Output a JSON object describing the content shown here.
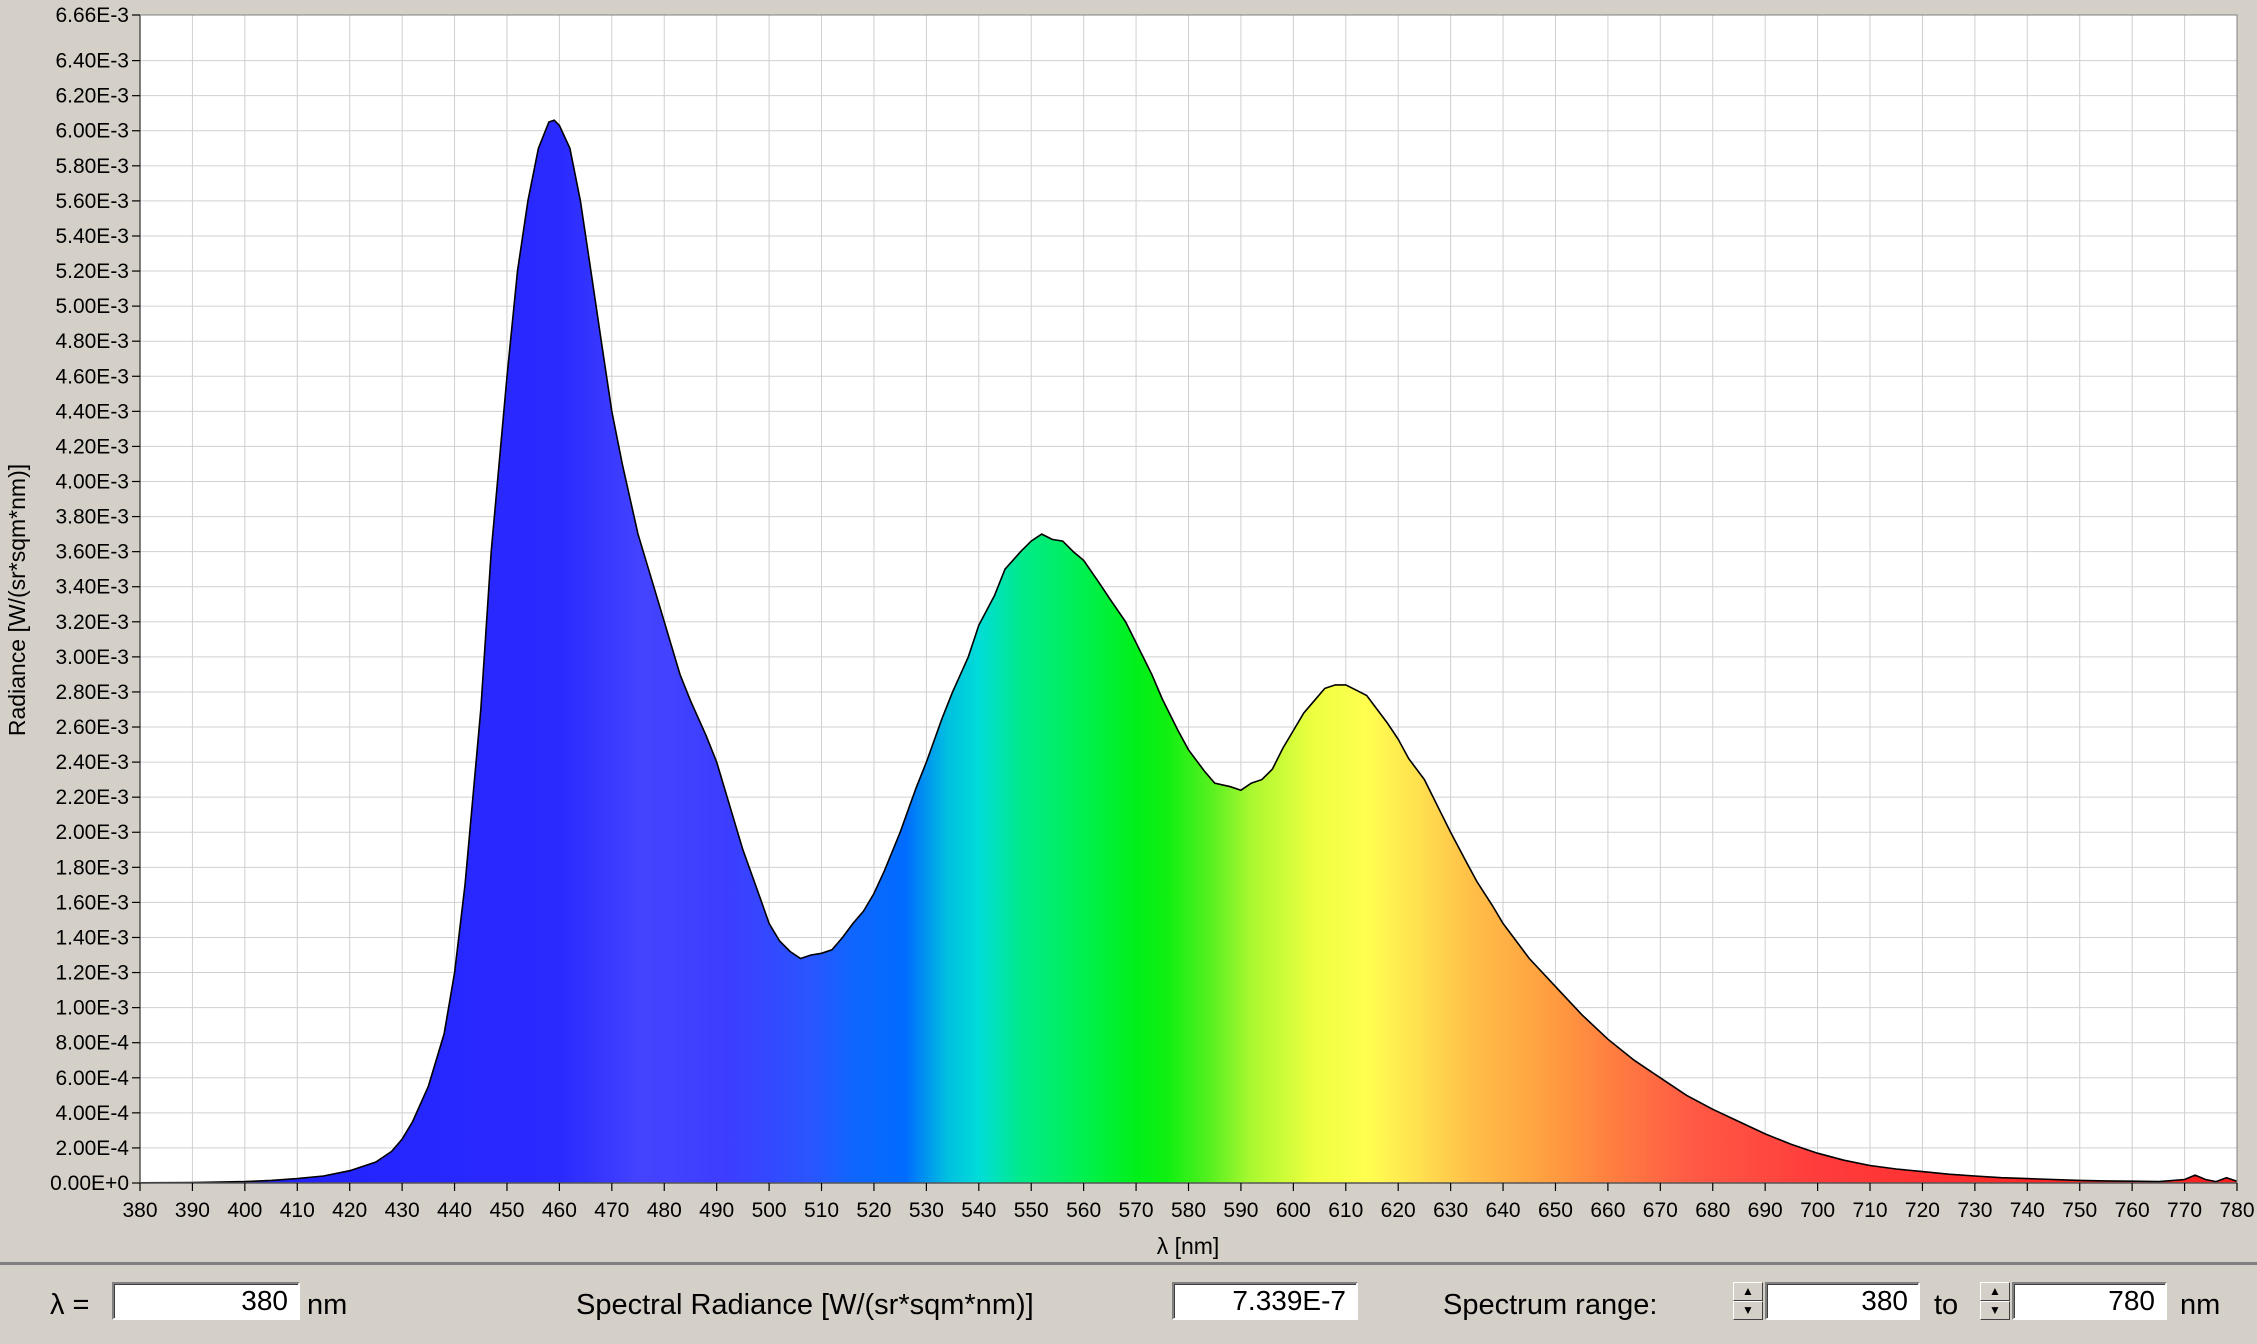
{
  "chart_data": {
    "type": "area",
    "xlabel": "λ [nm]",
    "ylabel": "Radiance [W/(sr*sqm*nm)]",
    "xlim": [
      380,
      780
    ],
    "ylim": [
      0,
      0.00666
    ],
    "x_ticks": [
      "380",
      "390",
      "400",
      "410",
      "420",
      "430",
      "440",
      "450",
      "460",
      "470",
      "480",
      "490",
      "500",
      "510",
      "520",
      "530",
      "540",
      "550",
      "560",
      "570",
      "580",
      "590",
      "600",
      "610",
      "620",
      "630",
      "640",
      "650",
      "660",
      "670",
      "680",
      "690",
      "700",
      "710",
      "720",
      "730",
      "740",
      "750",
      "760",
      "770",
      "780"
    ],
    "y_tick_values": [
      0,
      0.0002,
      0.0004,
      0.0006,
      0.0008,
      0.001,
      0.0012,
      0.0014,
      0.0016,
      0.0018,
      0.002,
      0.0022,
      0.0024,
      0.0026,
      0.0028,
      0.003,
      0.0032,
      0.0034,
      0.0036,
      0.0038,
      0.004,
      0.0042,
      0.0044,
      0.0046,
      0.0048,
      0.005,
      0.0052,
      0.0054,
      0.0056,
      0.0058,
      0.006,
      0.0062,
      0.0064,
      0.00666
    ],
    "y_tick_labels": [
      "0.00E+0",
      "2.00E-4",
      "4.00E-4",
      "6.00E-4",
      "8.00E-4",
      "1.00E-3",
      "1.20E-3",
      "1.40E-3",
      "1.60E-3",
      "1.80E-3",
      "2.00E-3",
      "2.20E-3",
      "2.40E-3",
      "2.60E-3",
      "2.80E-3",
      "3.00E-3",
      "3.20E-3",
      "3.40E-3",
      "3.60E-3",
      "3.80E-3",
      "4.00E-3",
      "4.20E-3",
      "4.40E-3",
      "4.60E-3",
      "4.80E-3",
      "5.00E-3",
      "5.20E-3",
      "5.40E-3",
      "5.60E-3",
      "5.80E-3",
      "6.00E-3",
      "6.20E-3",
      "6.40E-3",
      "6.66E-3"
    ],
    "grid": true,
    "x": [
      380,
      390,
      400,
      405,
      410,
      415,
      420,
      425,
      428,
      430,
      432,
      435,
      438,
      440,
      442,
      445,
      447,
      450,
      452,
      454,
      456,
      458,
      459,
      460,
      462,
      464,
      466,
      468,
      470,
      472,
      475,
      478,
      480,
      483,
      485,
      488,
      490,
      493,
      495,
      498,
      500,
      502,
      504,
      506,
      508,
      510,
      512,
      514,
      516,
      518,
      520,
      522,
      525,
      528,
      530,
      533,
      535,
      538,
      540,
      543,
      545,
      548,
      550,
      552,
      554,
      556,
      558,
      560,
      563,
      565,
      568,
      570,
      573,
      575,
      578,
      580,
      583,
      585,
      588,
      590,
      592,
      594,
      596,
      598,
      600,
      602,
      604,
      606,
      608,
      610,
      612,
      614,
      616,
      618,
      620,
      622,
      625,
      628,
      630,
      633,
      635,
      638,
      640,
      645,
      650,
      655,
      660,
      665,
      670,
      675,
      680,
      685,
      690,
      695,
      700,
      705,
      710,
      715,
      720,
      725,
      730,
      735,
      740,
      745,
      750,
      755,
      760,
      765,
      770,
      772,
      774,
      776,
      778,
      780
    ],
    "values": [
      1e-06,
      3e-06,
      8e-06,
      1.5e-05,
      2.5e-05,
      4e-05,
      7e-05,
      0.00012,
      0.00018,
      0.00025,
      0.00035,
      0.00055,
      0.00085,
      0.0012,
      0.0017,
      0.0027,
      0.0036,
      0.0046,
      0.0052,
      0.0056,
      0.0059,
      0.00605,
      0.00606,
      0.00603,
      0.0059,
      0.0056,
      0.0052,
      0.0048,
      0.0044,
      0.0041,
      0.0037,
      0.0034,
      0.0032,
      0.0029,
      0.00275,
      0.00255,
      0.0024,
      0.0021,
      0.0019,
      0.00165,
      0.00148,
      0.00138,
      0.00132,
      0.00128,
      0.0013,
      0.00131,
      0.00133,
      0.0014,
      0.00148,
      0.00155,
      0.00165,
      0.00178,
      0.002,
      0.00225,
      0.0024,
      0.00265,
      0.0028,
      0.003,
      0.00318,
      0.00335,
      0.0035,
      0.0036,
      0.00366,
      0.0037,
      0.00367,
      0.00366,
      0.0036,
      0.00355,
      0.00342,
      0.00333,
      0.0032,
      0.00308,
      0.0029,
      0.00276,
      0.00258,
      0.00247,
      0.00235,
      0.00228,
      0.00226,
      0.00224,
      0.00228,
      0.0023,
      0.00236,
      0.00248,
      0.00258,
      0.00268,
      0.00275,
      0.00282,
      0.00284,
      0.00284,
      0.00281,
      0.00278,
      0.0027,
      0.00262,
      0.00253,
      0.00242,
      0.0023,
      0.00212,
      0.002,
      0.00183,
      0.00172,
      0.00158,
      0.00148,
      0.00128,
      0.00112,
      0.00096,
      0.00082,
      0.0007,
      0.0006,
      0.0005,
      0.00042,
      0.00035,
      0.00028,
      0.00022,
      0.00017,
      0.00013,
      0.0001,
      8e-05,
      6.5e-05,
      5e-05,
      4e-05,
      3e-05,
      2.5e-05,
      2e-05,
      1.5e-05,
      1.2e-05,
      1e-05,
      8e-06,
      2e-05,
      4.5e-05,
      2e-05,
      8e-06,
      3e-05,
      1e-05
    ]
  },
  "bottom_bar": {
    "lambda_label": "λ =",
    "lambda_value": "380",
    "lambda_unit": "nm",
    "radiance_label": "Spectral Radiance [W/(sr*sqm*nm)]",
    "radiance_value": "7.339E-7",
    "range_label": "Spectrum range:",
    "range_from": "380",
    "range_to_label": "to",
    "range_to": "780",
    "range_unit": "nm",
    "spin_up": "▲",
    "spin_down": "▼"
  }
}
